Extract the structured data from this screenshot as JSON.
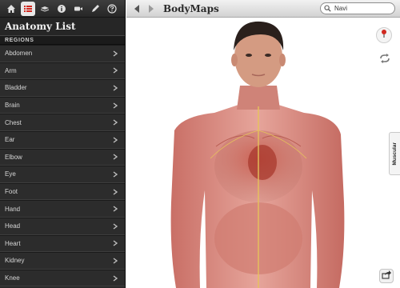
{
  "toolbar": {
    "icons": [
      "home-icon",
      "list-icon",
      "layers-icon",
      "info-icon",
      "video-icon",
      "pen-icon",
      "help-icon"
    ],
    "active_icon": "list-icon"
  },
  "sidebar": {
    "title": "Anatomy List",
    "section_header": "REGIONS",
    "items": [
      {
        "label": "Abdomen"
      },
      {
        "label": "Arm"
      },
      {
        "label": "Bladder"
      },
      {
        "label": "Brain"
      },
      {
        "label": "Chest"
      },
      {
        "label": "Ear"
      },
      {
        "label": "Elbow"
      },
      {
        "label": "Eye"
      },
      {
        "label": "Foot"
      },
      {
        "label": "Hand"
      },
      {
        "label": "Head"
      },
      {
        "label": "Heart"
      },
      {
        "label": "Kidney"
      },
      {
        "label": "Knee"
      }
    ]
  },
  "header": {
    "title": "BodyMaps",
    "search_value": "Navi"
  },
  "viewer": {
    "layer_tab_label": "Muscular",
    "controls": [
      "pin-icon",
      "rotate-icon",
      "share-icon"
    ]
  },
  "colors": {
    "sidebar_bg": "#2a2a2a",
    "accent_red": "#d0281f",
    "skin_muscle": "#d88a80"
  }
}
